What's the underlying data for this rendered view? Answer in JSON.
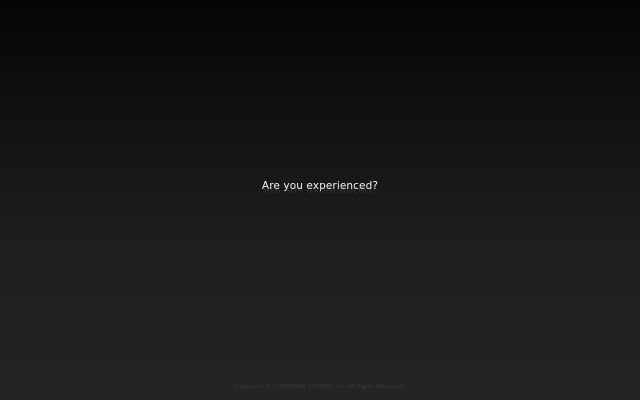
{
  "intro": {
    "tagline": "Are you experienced?"
  },
  "footer": {
    "copyright": "Copyright © 2009 PRIME STUDIOS Inc. All Rights Reserved."
  },
  "colors": {
    "background_top": "#050505",
    "background_bottom": "#242424",
    "tagline": "#f2f2f2",
    "footer_text": "#3c3c3c"
  }
}
